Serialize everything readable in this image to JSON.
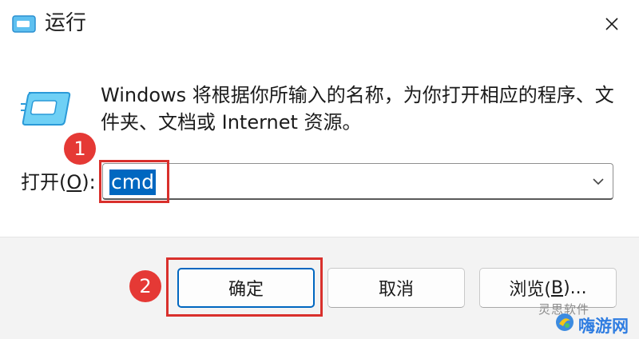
{
  "window": {
    "title": "运行",
    "title_icon": "run-app-icon",
    "close_icon": "close-icon"
  },
  "body": {
    "icon": "run-app-icon",
    "description": "Windows 将根据你所输入的名称，为你打开相应的程序、文件夹、文档或 Internet 资源。",
    "open_label_prefix": "打开(",
    "open_label_accel": "O",
    "open_label_suffix": "):",
    "input_value": "cmd"
  },
  "buttons": {
    "ok": "确定",
    "cancel": "取消",
    "browse_prefix": "浏览(",
    "browse_accel": "B",
    "browse_suffix": ")..."
  },
  "annotations": {
    "step1": "1",
    "step2": "2"
  },
  "watermark": {
    "top": "灵思软件",
    "brand": "嗨游网"
  },
  "colors": {
    "accent": "#0067c0",
    "annotation": "#d9302c",
    "footer_bg": "#f3f3f3"
  }
}
